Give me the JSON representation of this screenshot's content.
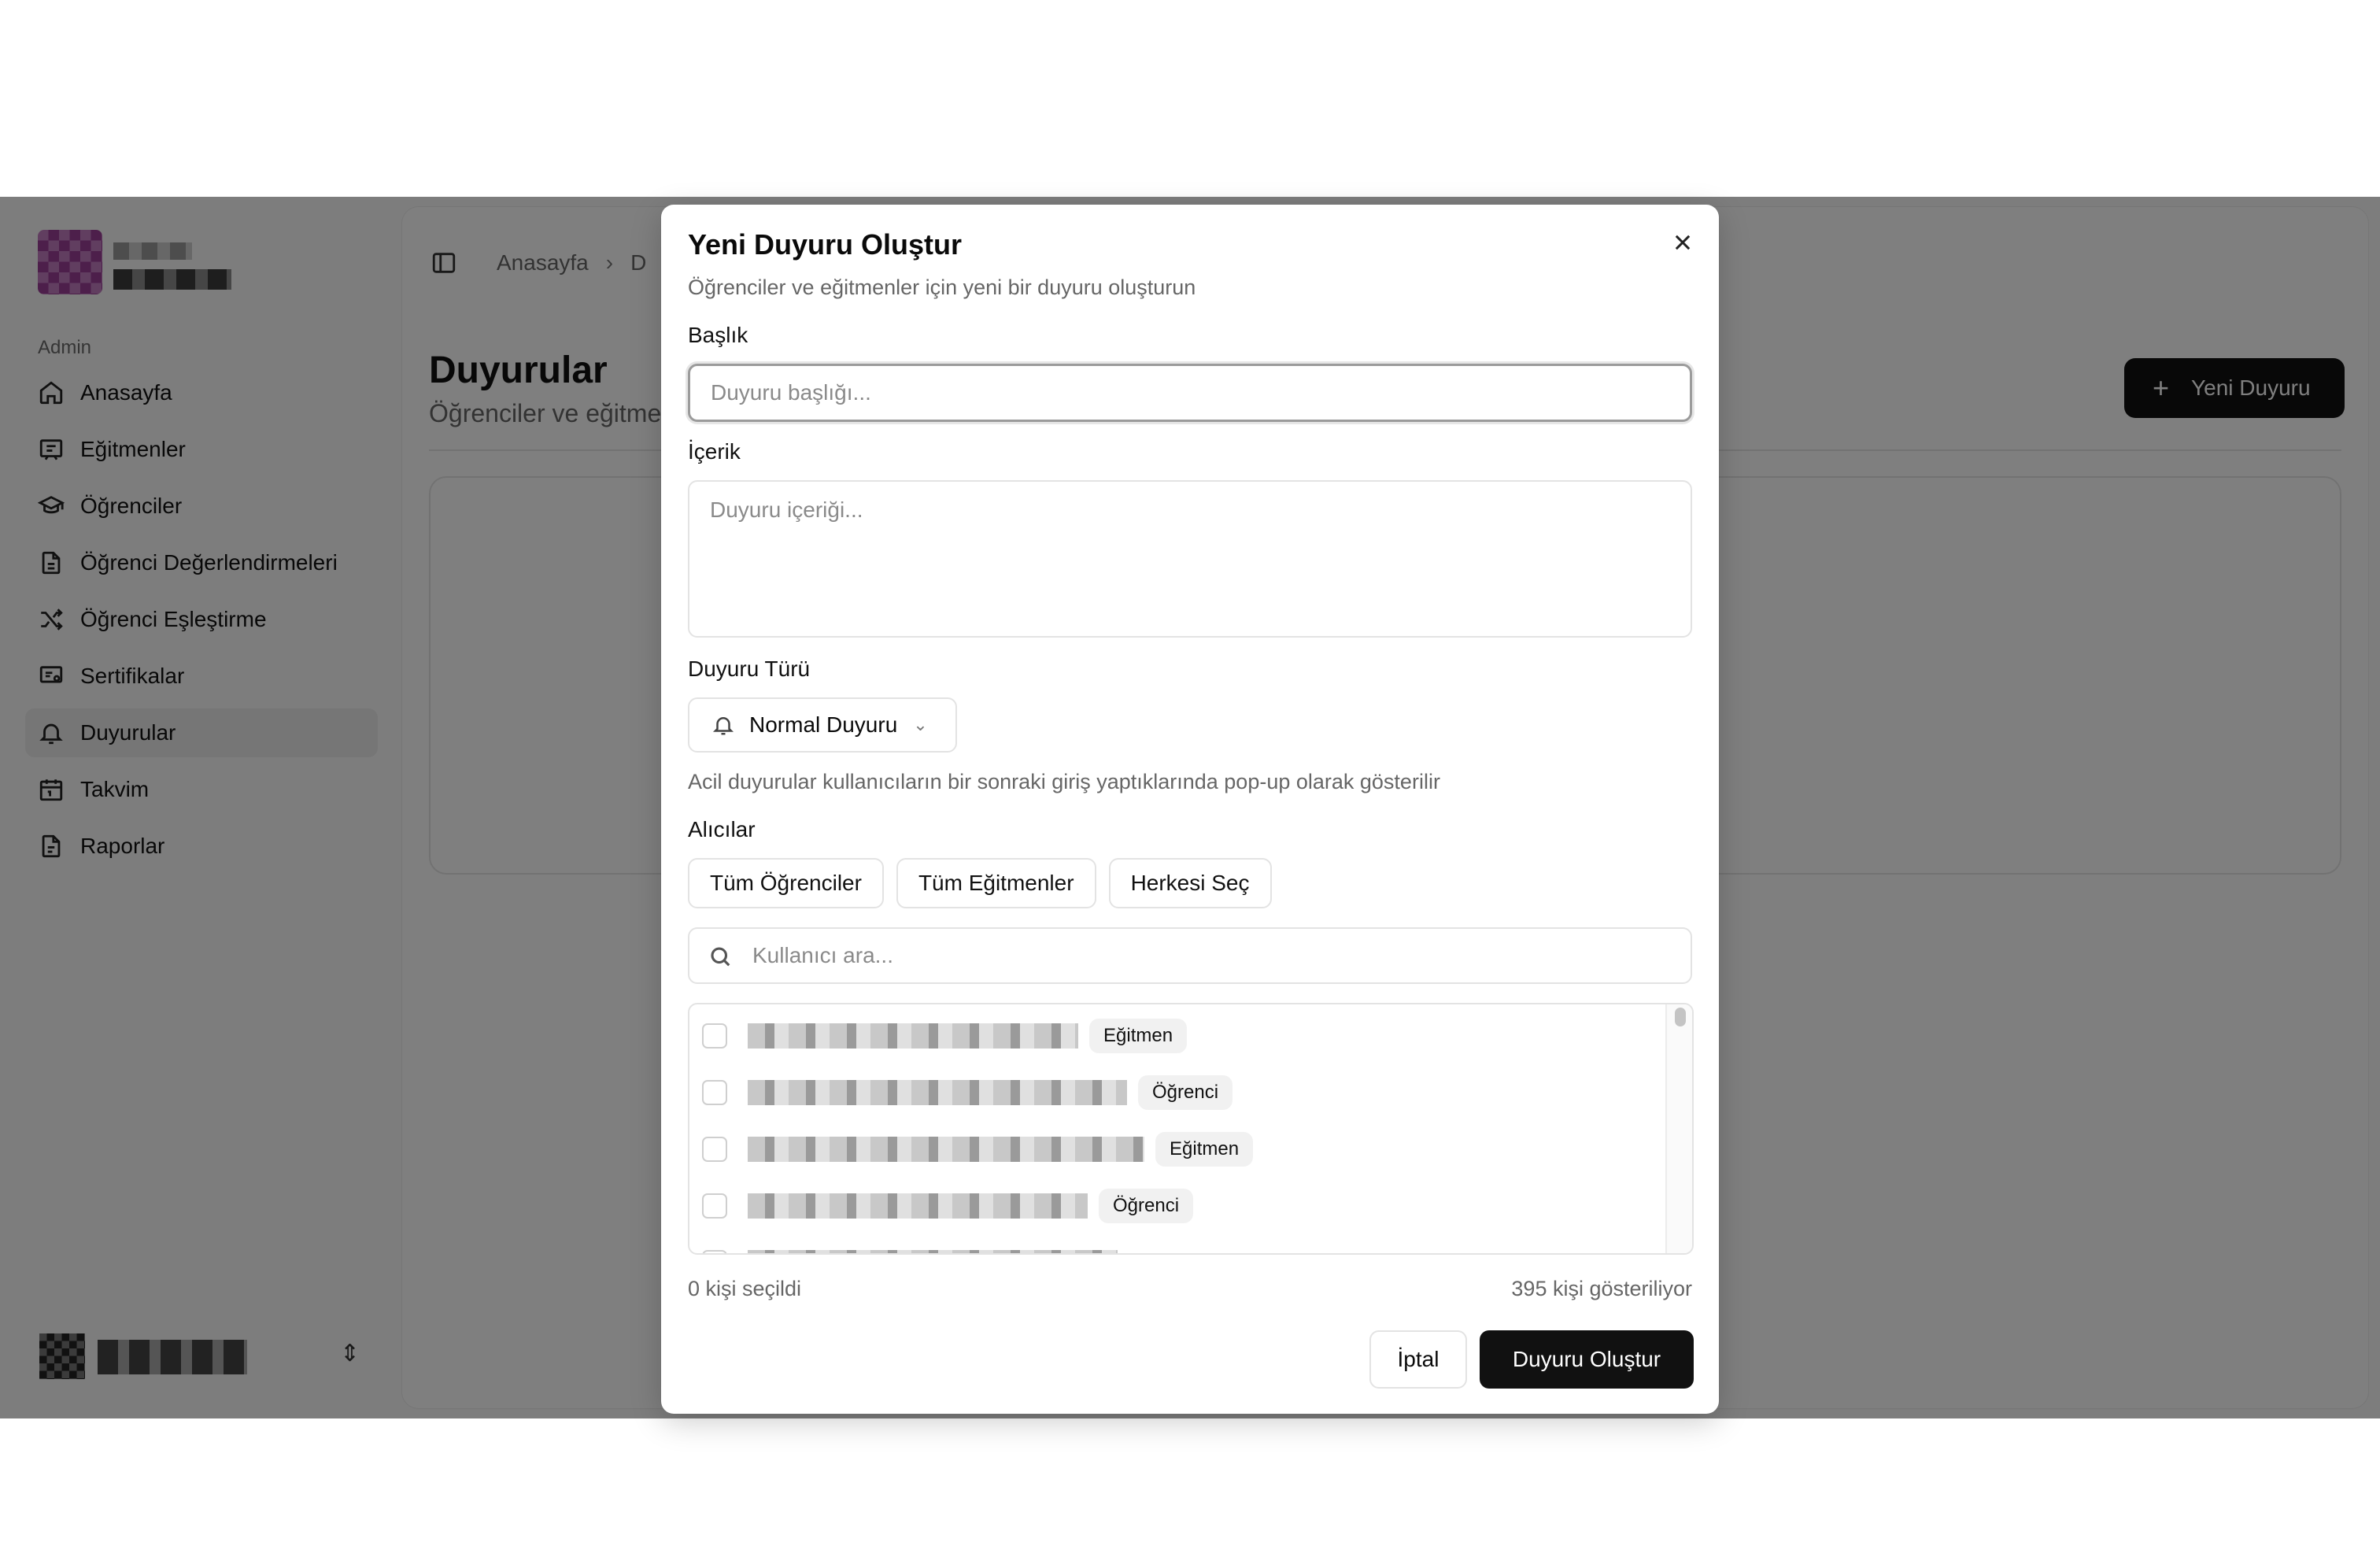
{
  "sidebar": {
    "section_label": "Admin",
    "items": [
      {
        "label": "Anasayfa",
        "icon": "home-icon"
      },
      {
        "label": "Eğitmenler",
        "icon": "presentation-icon"
      },
      {
        "label": "Öğrenciler",
        "icon": "graduation-cap-icon"
      },
      {
        "label": "Öğrenci Değerlendirmeleri",
        "icon": "file-text-icon"
      },
      {
        "label": "Öğrenci Eşleştirme",
        "icon": "shuffle-icon"
      },
      {
        "label": "Sertifikalar",
        "icon": "certificate-icon"
      },
      {
        "label": "Duyurular",
        "icon": "bell-icon",
        "active": true
      },
      {
        "label": "Takvim",
        "icon": "calendar-icon"
      },
      {
        "label": "Raporlar",
        "icon": "report-icon"
      }
    ]
  },
  "header": {
    "breadcrumb_home": "Anasayfa",
    "breadcrumb_current": "D"
  },
  "page": {
    "title": "Duyurular",
    "subtitle": "Öğrenciler ve eğitme",
    "new_button": "Yeni Duyuru"
  },
  "modal": {
    "title": "Yeni Duyuru Oluştur",
    "subtitle": "Öğrenciler ve eğitmenler için yeni bir duyuru oluşturun",
    "title_label": "Başlık",
    "title_placeholder": "Duyuru başlığı...",
    "content_label": "İçerik",
    "content_placeholder": "Duyuru içeriği...",
    "type_label": "Duyuru Türü",
    "type_value": "Normal Duyuru",
    "type_hint": "Acil duyurular kullanıcıların bir sonraki giriş yaptıklarında pop-up olarak gösterilir",
    "recipients_label": "Alıcılar",
    "recipient_buttons": [
      "Tüm Öğrenciler",
      "Tüm Eğitmenler",
      "Herkesi Seç"
    ],
    "search_placeholder": "Kullanıcı ara...",
    "users": [
      {
        "role": "Eğitmen"
      },
      {
        "role": "Öğrenci"
      },
      {
        "role": "Eğitmen"
      },
      {
        "role": "Öğrenci"
      }
    ],
    "selected_count": "0 kişi seçildi",
    "shown_count": "395 kişi gösteriliyor",
    "cancel": "İptal",
    "submit": "Duyuru Oluştur"
  }
}
